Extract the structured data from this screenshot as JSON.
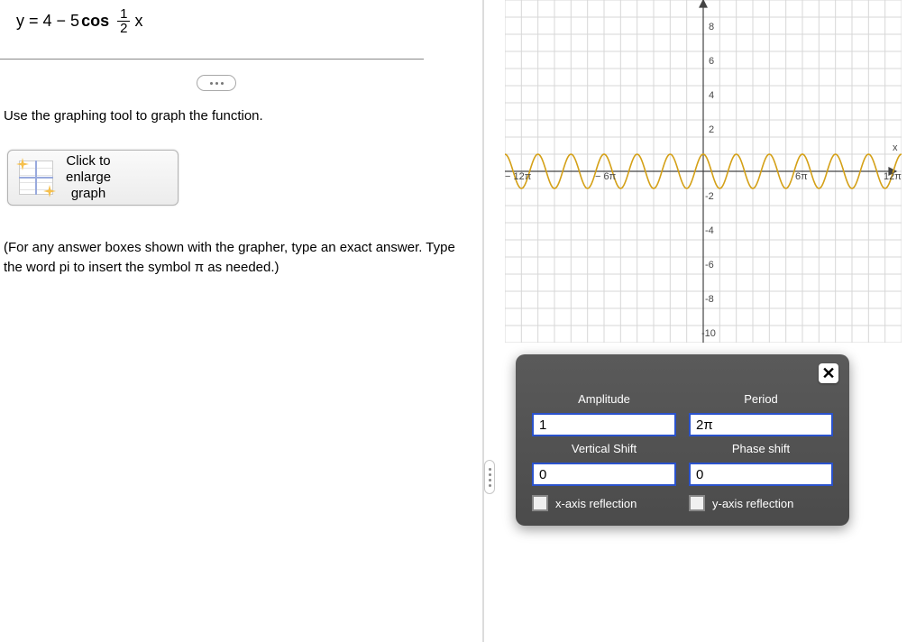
{
  "equation": {
    "prefix": "y = 4 − 5 ",
    "func": "cos",
    "frac_num": "1",
    "frac_den": "2",
    "suffix": "x"
  },
  "instruction": "Use the graphing tool to graph the function.",
  "enlarge_button": {
    "line1": "Click to",
    "line2": "enlarge",
    "line3": "graph"
  },
  "hint": "(For any answer boxes shown with the grapher, type an exact answer. Type the word pi to insert the symbol π as needed.)",
  "panel": {
    "labels": {
      "amplitude": "Amplitude",
      "period": "Period",
      "vshift": "Vertical Shift",
      "phshift": "Phase shift",
      "xrefl": "x-axis reflection",
      "yrefl": "y-axis reflection"
    },
    "values": {
      "amplitude": "1",
      "period": "2π",
      "vshift": "0",
      "phshift": "0"
    }
  },
  "chart_data": {
    "type": "line",
    "title": "",
    "xlabel": "x",
    "ylabel": "",
    "xlim_pi": [
      -12,
      12
    ],
    "ylim": [
      -10,
      10
    ],
    "xticks": [
      "−12π",
      "−6π",
      "6π",
      "12π"
    ],
    "yticks": [
      8,
      6,
      4,
      2,
      -2,
      -4,
      -6,
      -8,
      -10
    ],
    "series": [
      {
        "name": "cos",
        "equation": "y = cos(x)",
        "amplitude": 1,
        "period_pi": 2,
        "vshift": 0,
        "phshift": 0,
        "color": "#d4a017"
      }
    ]
  }
}
